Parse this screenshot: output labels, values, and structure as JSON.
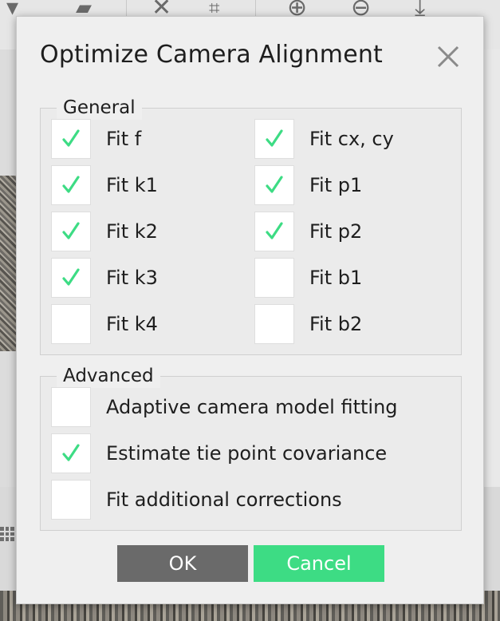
{
  "dialog": {
    "title": "Optimize Camera Alignment",
    "close_icon": "close-icon"
  },
  "general": {
    "label": "General",
    "left_column": [
      {
        "label": "Fit f",
        "checked": true
      },
      {
        "label": "Fit k1",
        "checked": true
      },
      {
        "label": "Fit k2",
        "checked": true
      },
      {
        "label": "Fit k3",
        "checked": true
      },
      {
        "label": "Fit k4",
        "checked": false
      }
    ],
    "right_column": [
      {
        "label": "Fit cx, cy",
        "checked": true
      },
      {
        "label": "Fit p1",
        "checked": true
      },
      {
        "label": "Fit p2",
        "checked": true
      },
      {
        "label": "Fit b1",
        "checked": false
      },
      {
        "label": "Fit b2",
        "checked": false
      }
    ]
  },
  "advanced": {
    "label": "Advanced",
    "options": [
      {
        "label": "Adaptive camera model fitting",
        "checked": false
      },
      {
        "label": "Estimate tie point covariance",
        "checked": true
      },
      {
        "label": "Fit additional corrections",
        "checked": false
      }
    ]
  },
  "buttons": {
    "ok": "OK",
    "cancel": "Cancel"
  },
  "colors": {
    "checkmark": "#3ddc84",
    "ok_button": "#6a6a6a",
    "cancel_button": "#3ddc84"
  },
  "background_toolbar_icons": [
    "ruler-icon",
    "close-icon",
    "crop-icon",
    "zoom-in-icon",
    "zoom-out-icon",
    "fit-icon"
  ]
}
